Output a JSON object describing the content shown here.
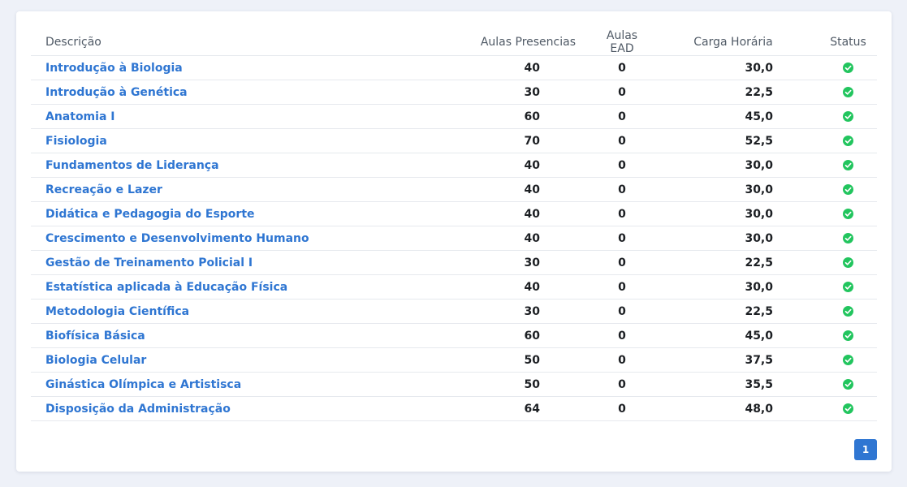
{
  "table": {
    "headers": {
      "description": "Descrição",
      "presential": "Aulas Presencias",
      "ead": "Aulas EAD",
      "workload": "Carga Horária",
      "status": "Status"
    },
    "rows": [
      {
        "description": "Introdução à Biologia",
        "presential": "40",
        "ead": "0",
        "workload": "30,0",
        "status": "check-circle-icon"
      },
      {
        "description": "Introdução à Genética",
        "presential": "30",
        "ead": "0",
        "workload": "22,5",
        "status": "check-circle-icon"
      },
      {
        "description": "Anatomia I",
        "presential": "60",
        "ead": "0",
        "workload": "45,0",
        "status": "check-circle-icon"
      },
      {
        "description": "Fisiologia",
        "presential": "70",
        "ead": "0",
        "workload": "52,5",
        "status": "check-circle-icon"
      },
      {
        "description": "Fundamentos de Liderança",
        "presential": "40",
        "ead": "0",
        "workload": "30,0",
        "status": "check-circle-icon"
      },
      {
        "description": "Recreação e Lazer",
        "presential": "40",
        "ead": "0",
        "workload": "30,0",
        "status": "check-circle-icon"
      },
      {
        "description": "Didática e Pedagogia do Esporte",
        "presential": "40",
        "ead": "0",
        "workload": "30,0",
        "status": "check-circle-icon"
      },
      {
        "description": "Crescimento e Desenvolvimento Humano",
        "presential": "40",
        "ead": "0",
        "workload": "30,0",
        "status": "check-circle-icon"
      },
      {
        "description": "Gestão de Treinamento Policial I",
        "presential": "30",
        "ead": "0",
        "workload": "22,5",
        "status": "check-circle-icon"
      },
      {
        "description": "Estatística aplicada à Educação Física",
        "presential": "40",
        "ead": "0",
        "workload": "30,0",
        "status": "check-circle-icon"
      },
      {
        "description": "Metodologia Científica",
        "presential": "30",
        "ead": "0",
        "workload": "22,5",
        "status": "check-circle-icon"
      },
      {
        "description": "Biofísica Básica",
        "presential": "60",
        "ead": "0",
        "workload": "45,0",
        "status": "check-circle-icon"
      },
      {
        "description": "Biologia Celular",
        "presential": "50",
        "ead": "0",
        "workload": "37,5",
        "status": "check-circle-icon"
      },
      {
        "description": "Ginástica Olímpica e Artistisca",
        "presential": "50",
        "ead": "0",
        "workload": "35,5",
        "status": "check-circle-icon"
      },
      {
        "description": "Disposição da Administração",
        "presential": "64",
        "ead": "0",
        "workload": "48,0",
        "status": "check-circle-icon"
      }
    ]
  },
  "pagination": {
    "current_page": "1"
  },
  "colors": {
    "link": "#2f76d2",
    "status_ok": "#22c55e",
    "page_button": "#2f76d2",
    "background": "#eef1f8"
  }
}
